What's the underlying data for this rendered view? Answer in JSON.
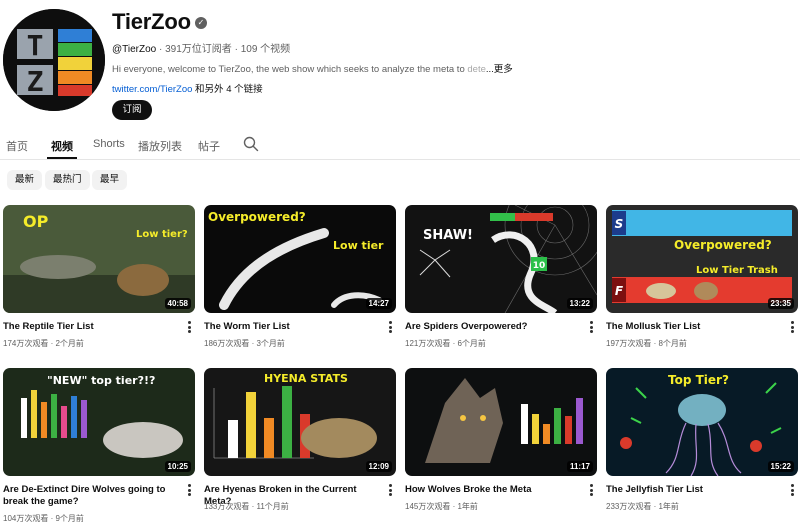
{
  "channel": {
    "name": "TierZoo",
    "handle": "@TierZoo",
    "stats": " · 391万位订阅者 · 109 个视频",
    "description": "Hi everyone, welcome to TierZoo, the web show which seeks to analyze the meta to ",
    "description_fade": "dete",
    "more_label": "...更多",
    "link": "twitter.com/TierZoo",
    "link_extra": " 和另外 4 个链接",
    "subscribe_label": "订阅",
    "avatar_letters": [
      "T",
      "Z"
    ]
  },
  "tabs": [
    {
      "label": "首页"
    },
    {
      "label": "视频",
      "active": true
    },
    {
      "label": "Shorts"
    },
    {
      "label": "播放列表"
    },
    {
      "label": "帖子"
    }
  ],
  "chips": [
    "最新",
    "最热门",
    "最早"
  ],
  "videos": [
    {
      "title": "The Reptile Tier List",
      "views": "174万次观看",
      "age": "2个月前",
      "duration": "40:58",
      "thumb_text": [
        "OP",
        "Low tier?"
      ]
    },
    {
      "title": "The Worm Tier List",
      "views": "186万次观看",
      "age": "3个月前",
      "duration": "14:27",
      "thumb_text": [
        "Overpowered?",
        "Low tier"
      ]
    },
    {
      "title": "Are Spiders Overpowered?",
      "views": "121万次观看",
      "age": "6个月前",
      "duration": "13:22",
      "thumb_text": [
        "SHAW!",
        "10"
      ]
    },
    {
      "title": "The Mollusk Tier List",
      "views": "197万次观看",
      "age": "8个月前",
      "duration": "23:35",
      "thumb_text": [
        "S",
        "Overpowered?",
        "Low Tier Trash",
        "F"
      ]
    },
    {
      "title": "Are De-Extinct Dire Wolves going to break the game?",
      "views": "104万次观看",
      "age": "9个月前",
      "duration": "10:25",
      "thumb_text": [
        "\"NEW\" top tier?!?"
      ]
    },
    {
      "title": "Are Hyenas Broken in the Current Meta?",
      "views": "133万次观看",
      "age": "11个月前",
      "duration": "12:09",
      "thumb_text": [
        "HYENA STATS"
      ]
    },
    {
      "title": "How Wolves Broke the Meta",
      "views": "145万次观看",
      "age": "1年前",
      "duration": "11:17",
      "thumb_text": []
    },
    {
      "title": "The Jellyfish Tier List",
      "views": "233万次观看",
      "age": "1年前",
      "duration": "15:22",
      "thumb_text": [
        "Top Tier?"
      ]
    }
  ],
  "colors": {
    "link": "#065fd4",
    "tier_bars": [
      "#2f7fd6",
      "#3cb043",
      "#f1d23a",
      "#f08a24",
      "#d93a2b"
    ],
    "thumb_neon": "#f5ec2a"
  }
}
